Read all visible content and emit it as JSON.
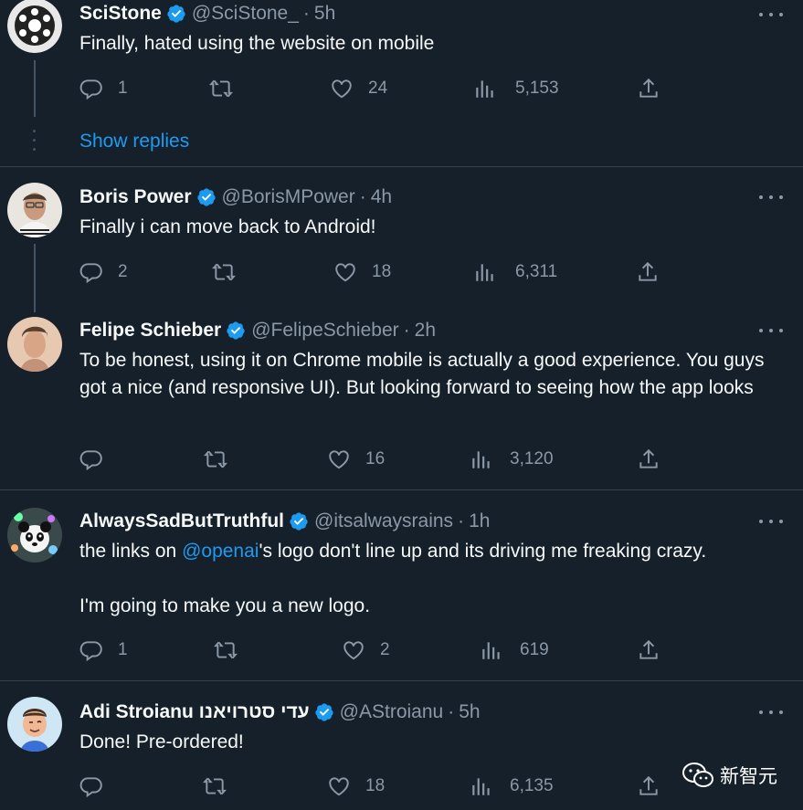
{
  "tweets": [
    {
      "name": "SciStone",
      "handle": "@SciStone_",
      "time": "5h",
      "text": "Finally, hated using the website on mobile",
      "replies": "1",
      "likes": "24",
      "views": "5,153",
      "show_replies": "Show replies"
    },
    {
      "name": "Boris Power",
      "handle": "@BorisMPower",
      "time": "4h",
      "text": "Finally i can move back to Android!",
      "replies": "2",
      "likes": "18",
      "views": "6,311"
    },
    {
      "name": "Felipe Schieber",
      "handle": "@FelipeSchieber",
      "time": "2h",
      "text": "To be honest, using it on Chrome mobile is actually a good experience. You guys got a nice (and responsive UI). But looking forward to seeing how the app looks",
      "replies": "",
      "likes": "16",
      "views": "3,120"
    },
    {
      "name": "AlwaysSadButTruthful",
      "handle": "@itsalwaysrains",
      "time": "1h",
      "mention": "@openai",
      "text_after_mention": "'s logo don't line up and its driving me freaking crazy.",
      "text_prefix": "the links on ",
      "text_line2": "I'm going to make you a new logo.",
      "replies": "1",
      "likes": "2",
      "views": "619"
    },
    {
      "name": "Adi Stroianu עדי סטרויאנו",
      "handle": "@AStroianu",
      "time": "5h",
      "text": "Done! Pre-ordered!",
      "replies": "",
      "likes": "18",
      "views": "6,135"
    }
  ],
  "separator": "·",
  "watermark": "新智元",
  "colors": {
    "background": "#15202b",
    "accent": "#1d9bf0",
    "muted": "#8b98a5",
    "divider": "#38444d"
  },
  "icons": [
    "verified-badge-icon",
    "reply-icon",
    "retweet-icon",
    "like-icon",
    "views-icon",
    "share-icon",
    "more-icon",
    "wechat-icon"
  ]
}
